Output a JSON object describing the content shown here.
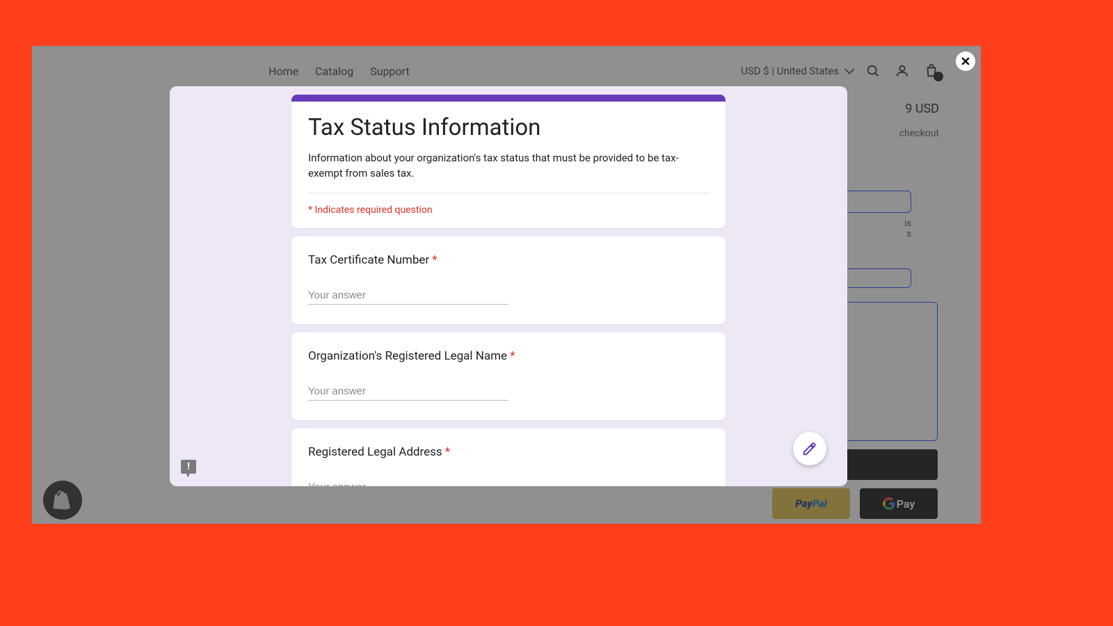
{
  "store": {
    "nav": {
      "home": "Home",
      "catalog": "Catalog",
      "support": "Support"
    },
    "currency": "USD $ | United States",
    "price_suffix": "9 USD",
    "shipping_suffix": "checkout",
    "side_text": "is\ns",
    "pay": {
      "paypal_p": "Pay",
      "paypal_pal": "Pal",
      "gpay": "Pay"
    }
  },
  "modal": {
    "title": "Tax Status Information",
    "description": "Information about your organization's tax status that must be provided to be tax-exempt from sales tax.",
    "required_note": "* Indicates required question",
    "answer_placeholder": "Your answer",
    "questions": [
      {
        "label": "Tax Certificate Number",
        "required": true
      },
      {
        "label": "Organization's Registered Legal Name",
        "required": true
      },
      {
        "label": "Registered Legal Address",
        "required": true
      }
    ]
  }
}
